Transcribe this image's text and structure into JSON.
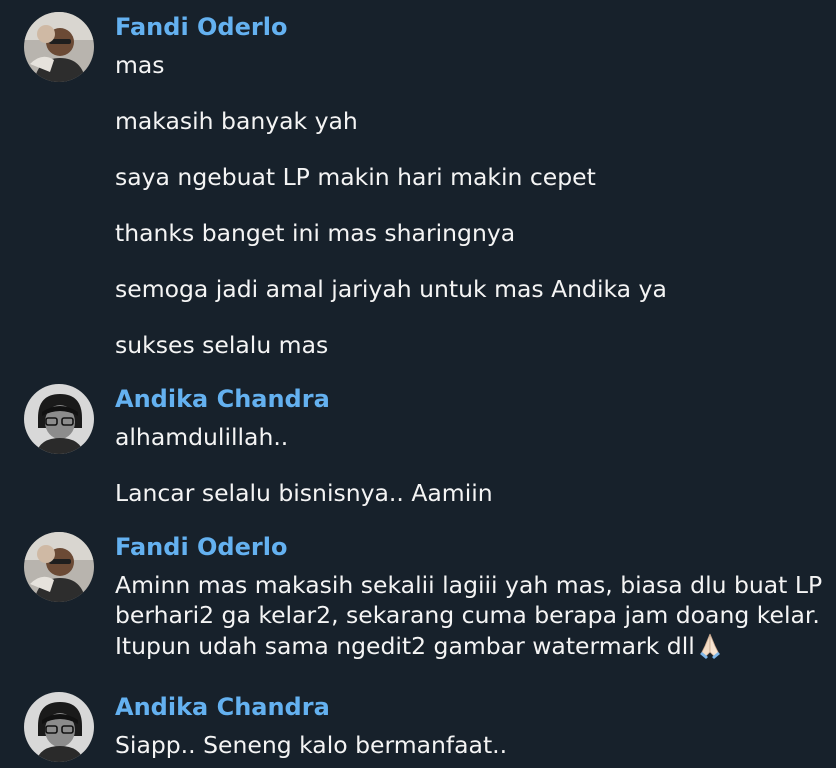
{
  "messages": [
    {
      "sender": "Fandi Oderlo",
      "avatar_icon": "avatar-photo-fandi",
      "lines": [
        "mas",
        "makasih banyak yah",
        "saya ngebuat LP makin hari makin cepet",
        "thanks banget ini mas sharingnya",
        "semoga jadi amal jariyah untuk mas Andika ya",
        "sukses selalu mas"
      ]
    },
    {
      "sender": "Andika Chandra",
      "avatar_icon": "avatar-photo-andika",
      "lines": [
        "alhamdulillah..",
        "Lancar selalu bisnisnya.. Aamiin"
      ]
    },
    {
      "sender": "Fandi Oderlo",
      "avatar_icon": "avatar-photo-fandi",
      "paragraph": [
        "Aminn mas makasih sekalii lagiii yah mas, biasa dlu buat LP",
        "berhari2 ga kelar2, sekarang cuma berapa jam doang kelar.",
        "Itupun udah sama ngedit2 gambar watermark dll"
      ],
      "trailing_emoji": "folded-hands-emoji"
    },
    {
      "sender": "Andika Chandra",
      "avatar_icon": "avatar-photo-andika",
      "lines": [
        "Siapp.. Seneng kalo bermanfaat.."
      ]
    }
  ],
  "colors": {
    "background": "#17212b",
    "sender_name": "#64b1f0",
    "message_text": "#f4f4f4"
  }
}
